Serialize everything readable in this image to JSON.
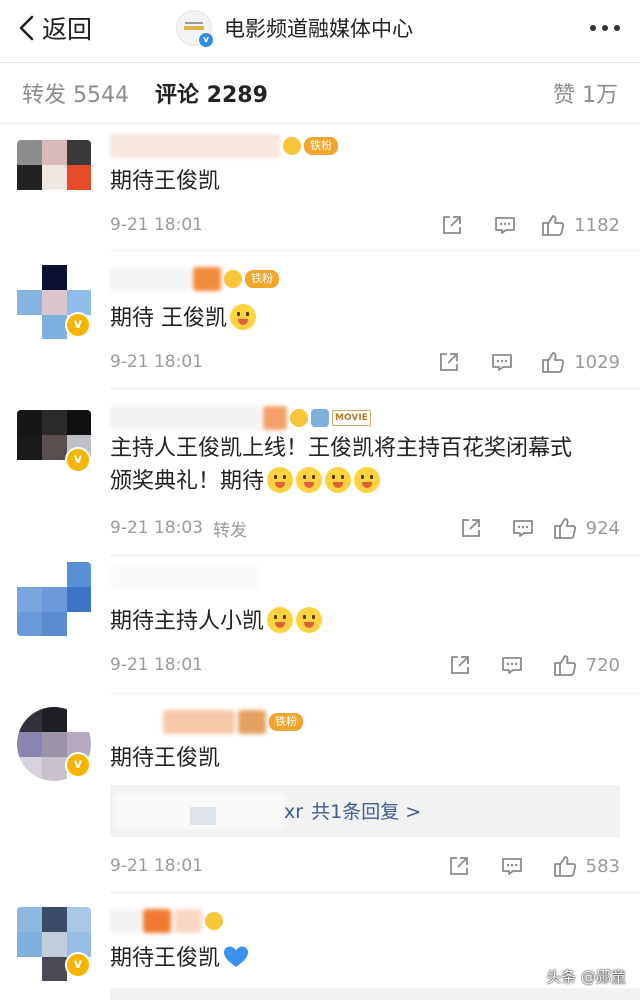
{
  "header": {
    "back_label": "返回",
    "account_name": "电影频道融媒体中心"
  },
  "tabs": {
    "repost": "转发 5544",
    "comment": "评论 2289",
    "likes": "赞 1万"
  },
  "comments": [
    {
      "text": "期待王俊凯",
      "time": "9-21 18:01",
      "likes": "1182",
      "badge": "铁粉"
    },
    {
      "text": "期待 王俊凯",
      "time": "9-21 18:01",
      "likes": "1029",
      "badge": "铁粉"
    },
    {
      "text_line1": "主持人王俊凯上线！王俊凯将主持百花奖闭幕式",
      "text_line2": "颁奖典礼！期待",
      "time": "9-21 18:03",
      "forward_label": "转发",
      "likes": "924",
      "badge": "MOVIE"
    },
    {
      "text": "期待主持人小凯",
      "time": "9-21 18:01",
      "likes": "720"
    },
    {
      "text": "期待王俊凯",
      "time": "9-21 18:01",
      "likes": "583",
      "badge": "铁粉",
      "reply_fragment": "xr",
      "reply_summary": "共1条回复 >"
    },
    {
      "text": "期待王俊凯"
    }
  ],
  "watermark": "头条 @郧童",
  "colors": {
    "link_blue": "#3f5c90",
    "meta_gray": "#9a9a9a",
    "verified_gold": "#f5b400",
    "fan_badge": "#f3a52b"
  },
  "icons": [
    "back-arrow-icon",
    "more-dots-icon",
    "share-icon",
    "comment-icon",
    "like-icon",
    "smile-emoji-icon",
    "blue-heart-icon"
  ]
}
